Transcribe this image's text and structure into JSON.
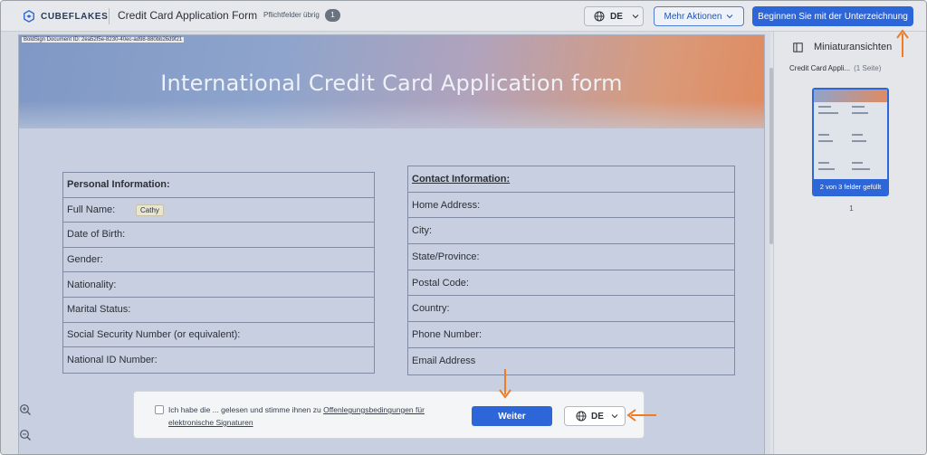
{
  "header": {
    "logo_text": "CUBEFLAKES",
    "doc_title": "Credit Card Application Form",
    "required_label": "Pflichtfelder übrig",
    "required_count": "1",
    "language": "DE",
    "more_actions": "Mehr Aktionen",
    "start_signing": "Beginnen Sie mit der Unterzeichnung"
  },
  "document": {
    "doc_id": "BoldSign Document ID: 2ea52f5e-8230-40ec-ad98-880bb26d9f21",
    "banner_title": "International Credit Card Application form",
    "personal": {
      "heading": "Personal Information:",
      "rows": [
        "Full Name:",
        "Date of Birth:",
        "Gender:",
        "Nationality:",
        "Marital Status:",
        "Social Security Number (or equivalent):",
        "National ID Number:"
      ],
      "full_name_value": "Cathy"
    },
    "contact": {
      "heading": "Contact Information:",
      "rows": [
        "Home Address:",
        "City:",
        "State/Province:",
        "Postal Code:",
        "Country:",
        "Phone Number:",
        "Email Address"
      ]
    }
  },
  "consent": {
    "text_prefix": "Ich habe die ... gelesen und stimme ihnen zu",
    "link_text": "Offenlegungsbedingungen für elektronische Signaturen",
    "continue_label": "Weiter",
    "language": "DE"
  },
  "thumbnails": {
    "title": "Miniaturansichten",
    "doc_name": "Credit Card Appli...",
    "page_count": "(1 Seite)",
    "filled_status": "2 von 3 felder gefüllt",
    "page_number": "1"
  },
  "colors": {
    "primary": "#2d66d8",
    "annotation_arrow": "#f07b22"
  },
  "icons": [
    "cubeflakes-logo",
    "globe-icon",
    "chevron-down-icon",
    "zoom-in-icon",
    "zoom-out-icon",
    "fit-screen-icon",
    "panel-icon",
    "arrow-annotation"
  ]
}
